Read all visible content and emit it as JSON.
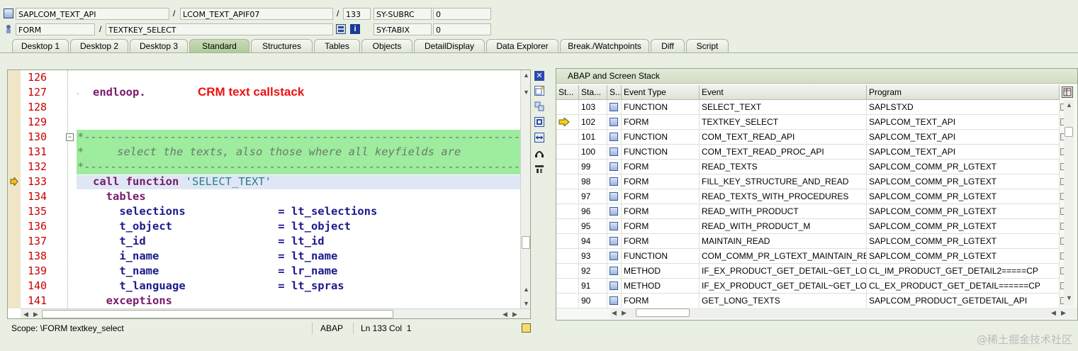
{
  "header": {
    "row1": {
      "program": "SAPLCOM_TEXT_API",
      "include": "LCOM_TEXT_APIF07",
      "line": "133",
      "var_name": "SY-SUBRC",
      "var_value": "0"
    },
    "row2": {
      "type": "FORM",
      "name": "TEXTKEY_SELECT",
      "var_name": "SY-TABIX",
      "var_value": "0"
    },
    "separator": "/"
  },
  "tabs": [
    {
      "label": "Desktop 1",
      "active": false
    },
    {
      "label": "Desktop 2",
      "active": false
    },
    {
      "label": "Desktop 3",
      "active": false
    },
    {
      "label": "Standard",
      "active": true
    },
    {
      "label": "Structures",
      "active": false
    },
    {
      "label": "Tables",
      "active": false
    },
    {
      "label": "Objects",
      "active": false
    },
    {
      "label": "DetailDisplay",
      "active": false
    },
    {
      "label": "Data Explorer",
      "active": false
    },
    {
      "label": "Break./Watchpoints",
      "active": false
    },
    {
      "label": "Diff",
      "active": false
    },
    {
      "label": "Script",
      "active": false
    }
  ],
  "editor": {
    "annotation": "CRM text callstack",
    "current_line": "133",
    "lines": [
      {
        "no": "126",
        "segs": []
      },
      {
        "no": "127",
        "segs": [
          {
            "t": "endloop.",
            "c": "kw"
          }
        ]
      },
      {
        "no": "128",
        "segs": []
      },
      {
        "no": "129",
        "segs": []
      },
      {
        "no": "130",
        "segs": [
          {
            "t": "*------------------------------------------------------------------",
            "c": "cm"
          }
        ]
      },
      {
        "no": "131",
        "segs": [
          {
            "t": "*     select the texts, also those where all keyfields are",
            "c": "cm"
          }
        ]
      },
      {
        "no": "132",
        "segs": [
          {
            "t": "*------------------------------------------------------------------",
            "c": "cm"
          }
        ]
      },
      {
        "no": "133",
        "segs": [
          {
            "t": "call function ",
            "c": "kw"
          },
          {
            "t": "'SELECT_TEXT'",
            "c": "str"
          }
        ]
      },
      {
        "no": "134",
        "segs": [
          {
            "t": "  tables",
            "c": "kw"
          }
        ]
      },
      {
        "no": "135",
        "segs": [
          {
            "t": "    selections              ",
            "c": "id"
          },
          {
            "t": "= ",
            "c": "id"
          },
          {
            "t": "lt_selections",
            "c": "id"
          }
        ]
      },
      {
        "no": "136",
        "segs": [
          {
            "t": "    t_object                ",
            "c": "id"
          },
          {
            "t": "= ",
            "c": "id"
          },
          {
            "t": "lt_object",
            "c": "id"
          }
        ]
      },
      {
        "no": "137",
        "segs": [
          {
            "t": "    t_id                    ",
            "c": "id"
          },
          {
            "t": "= ",
            "c": "id"
          },
          {
            "t": "lt_id",
            "c": "id"
          }
        ]
      },
      {
        "no": "138",
        "segs": [
          {
            "t": "    i_name                  ",
            "c": "id"
          },
          {
            "t": "= ",
            "c": "id"
          },
          {
            "t": "lt_name",
            "c": "id"
          }
        ]
      },
      {
        "no": "139",
        "segs": [
          {
            "t": "    t_name                  ",
            "c": "id"
          },
          {
            "t": "= ",
            "c": "id"
          },
          {
            "t": "lr_name",
            "c": "id"
          }
        ]
      },
      {
        "no": "140",
        "segs": [
          {
            "t": "    t_language              ",
            "c": "id"
          },
          {
            "t": "= ",
            "c": "id"
          },
          {
            "t": "lt_spras",
            "c": "id"
          }
        ]
      },
      {
        "no": "141",
        "segs": [
          {
            "t": "  exceptions",
            "c": "kw"
          }
        ]
      }
    ]
  },
  "statusbar": {
    "scope": "Scope: \\FORM textkey_select",
    "language": "ABAP",
    "position": "Ln 133 Col  1"
  },
  "stack": {
    "title": "ABAP and Screen Stack",
    "columns": [
      "St...",
      "Sta...",
      "S...",
      "Event Type",
      "Event",
      "Program"
    ],
    "current_row": 1,
    "rows": [
      {
        "level": "103",
        "type": "FUNCTION",
        "event": "SELECT_TEXT",
        "program": "SAPLSTXD"
      },
      {
        "level": "102",
        "type": "FORM",
        "event": "TEXTKEY_SELECT",
        "program": "SAPLCOM_TEXT_API"
      },
      {
        "level": "101",
        "type": "FUNCTION",
        "event": "COM_TEXT_READ_API",
        "program": "SAPLCOM_TEXT_API"
      },
      {
        "level": "100",
        "type": "FUNCTION",
        "event": "COM_TEXT_READ_PROC_API",
        "program": "SAPLCOM_TEXT_API"
      },
      {
        "level": "99",
        "type": "FORM",
        "event": "READ_TEXTS",
        "program": "SAPLCOM_COMM_PR_LGTEXT"
      },
      {
        "level": "98",
        "type": "FORM",
        "event": "FILL_KEY_STRUCTURE_AND_READ",
        "program": "SAPLCOM_COMM_PR_LGTEXT"
      },
      {
        "level": "97",
        "type": "FORM",
        "event": "READ_TEXTS_WITH_PROCEDURES",
        "program": "SAPLCOM_COMM_PR_LGTEXT"
      },
      {
        "level": "96",
        "type": "FORM",
        "event": "READ_WITH_PRODUCT",
        "program": "SAPLCOM_COMM_PR_LGTEXT"
      },
      {
        "level": "95",
        "type": "FORM",
        "event": "READ_WITH_PRODUCT_M",
        "program": "SAPLCOM_COMM_PR_LGTEXT"
      },
      {
        "level": "94",
        "type": "FORM",
        "event": "MAINTAIN_READ",
        "program": "SAPLCOM_COMM_PR_LGTEXT"
      },
      {
        "level": "93",
        "type": "FUNCTION",
        "event": "COM_COMM_PR_LGTEXT_MAINTAIN_RE",
        "program": "SAPLCOM_COMM_PR_LGTEXT"
      },
      {
        "level": "92",
        "type": "METHOD",
        "event": "IF_EX_PRODUCT_GET_DETAIL~GET_LO...",
        "program": "CL_IM_PRODUCT_GET_DETAIL2=====CP"
      },
      {
        "level": "91",
        "type": "METHOD",
        "event": "IF_EX_PRODUCT_GET_DETAIL~GET_LO...",
        "program": "CL_EX_PRODUCT_GET_DETAIL======CP"
      },
      {
        "level": "90",
        "type": "FORM",
        "event": "GET_LONG_TEXTS",
        "program": "SAPLCOM_PRODUCT_GETDETAIL_API"
      }
    ]
  },
  "watermark": "@稀土掘金技术社区",
  "icons": {
    "program": "program-icon",
    "form": "form-icon",
    "table": "table-row-icon",
    "pointer": "current-line-arrow-icon"
  }
}
